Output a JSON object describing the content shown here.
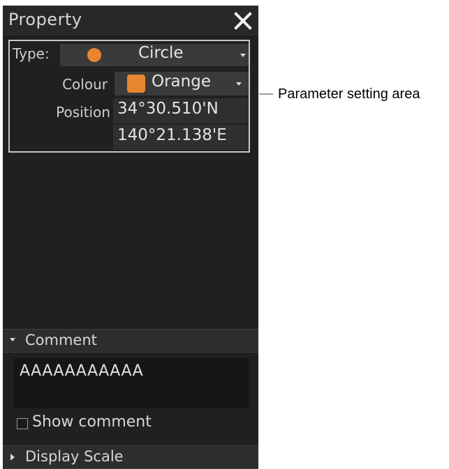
{
  "panel": {
    "title": "Property",
    "close_icon": "close-icon"
  },
  "params": {
    "type_label": "Type:",
    "type_value": "Circle",
    "type_symbol_color": "#e8862f",
    "colour_label": "Colour",
    "colour_value": "Orange",
    "colour_swatch": "#e8862f",
    "position_label": "Position",
    "latitude": "34°30.510'N",
    "longitude": "140°21.138'E"
  },
  "comment": {
    "header": "Comment",
    "text": "AAAAAAAAAAA",
    "show_label": "Show comment",
    "show_checked": false
  },
  "display_scale": {
    "header": "Display Scale"
  },
  "callout": {
    "label": "Parameter setting area"
  }
}
